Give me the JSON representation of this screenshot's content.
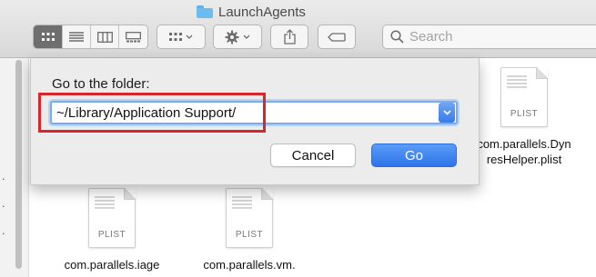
{
  "window": {
    "title": "LaunchAgents"
  },
  "toolbar": {
    "view_modes": [
      {
        "icon": "icon-view-icon",
        "active": true
      },
      {
        "icon": "list-view-icon",
        "active": false
      },
      {
        "icon": "column-view-icon",
        "active": false
      },
      {
        "icon": "gallery-view-icon",
        "active": false
      }
    ],
    "group_icon": "group-by-icon",
    "action_icon": "gear-icon",
    "share_icon": "share-icon",
    "tags_icon": "tag-icon",
    "search_placeholder": "Search"
  },
  "files": [
    {
      "name_lines": [
        "com.parallels.Dyn",
        "resHelper.plist"
      ],
      "kind": "PLIST"
    },
    {
      "name_lines": [
        "com.parallels.iage"
      ],
      "kind": "PLIST"
    },
    {
      "name_lines": [
        "com.parallels.vm."
      ],
      "kind": "PLIST"
    }
  ],
  "dialog": {
    "label": "Go to the folder:",
    "path_value": "~/Library/Application Support/",
    "cancel_label": "Cancel",
    "go_label": "Go"
  },
  "colors": {
    "accent": "#3a7ae8",
    "highlight_box": "#d8262c",
    "folder": "#6cbcf0"
  }
}
